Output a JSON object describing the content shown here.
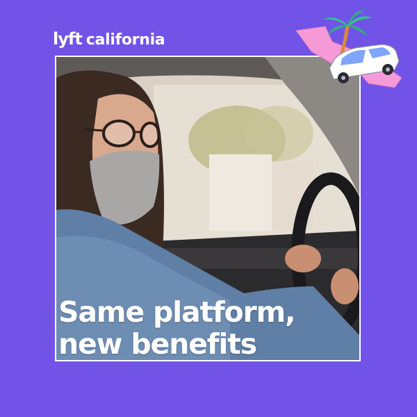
{
  "colors": {
    "background": "#7153e8",
    "frame_border": "#ffffff",
    "text": "#ffffff",
    "state_shape": "#f59ad7",
    "palm_leaves": "#34c48a",
    "car_body": "#ffffff",
    "car_window": "#7fa5ff"
  },
  "brand": {
    "logo_text": "lyft",
    "region_text": "california"
  },
  "headline": {
    "line1": "Same platform,",
    "line2": "new benefits"
  },
  "photo": {
    "subject": "woman-wearing-face-mask-driving-car"
  },
  "sticker": {
    "icons": [
      "california-map-icon",
      "palm-tree-icon",
      "car-icon"
    ]
  }
}
